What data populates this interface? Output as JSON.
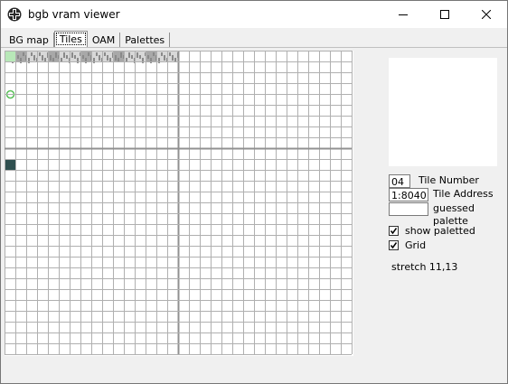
{
  "window": {
    "title": "bgb vram viewer",
    "icon": "bgb-app-icon",
    "controls": [
      "minimize-icon",
      "maximize-icon",
      "close-icon"
    ]
  },
  "tabs": [
    {
      "label": "BG map",
      "active": false
    },
    {
      "label": "Tiles",
      "active": true
    },
    {
      "label": "OAM",
      "active": false
    },
    {
      "label": "Palettes",
      "active": false
    }
  ],
  "tile_info": {
    "tile_number": "04",
    "tile_number_label": "Tile Number",
    "tile_address": "1:8040",
    "tile_address_label": "Tile Address",
    "guessed_palette": "",
    "guessed_palette_label": "guessed palette"
  },
  "options": {
    "show_paletted": {
      "label": "show paletted",
      "checked": true
    },
    "grid": {
      "label": "Grid",
      "checked": true
    }
  },
  "stretch_text": "stretch 11,13",
  "colors": {
    "grid_line": "#b0b0b0",
    "grid_major": "#909090",
    "tile_light": "#d8d8d8",
    "tile_mid": "#a8a8a8",
    "selected_tile": "#2f4f4f",
    "highlight_green": "#58c058"
  }
}
